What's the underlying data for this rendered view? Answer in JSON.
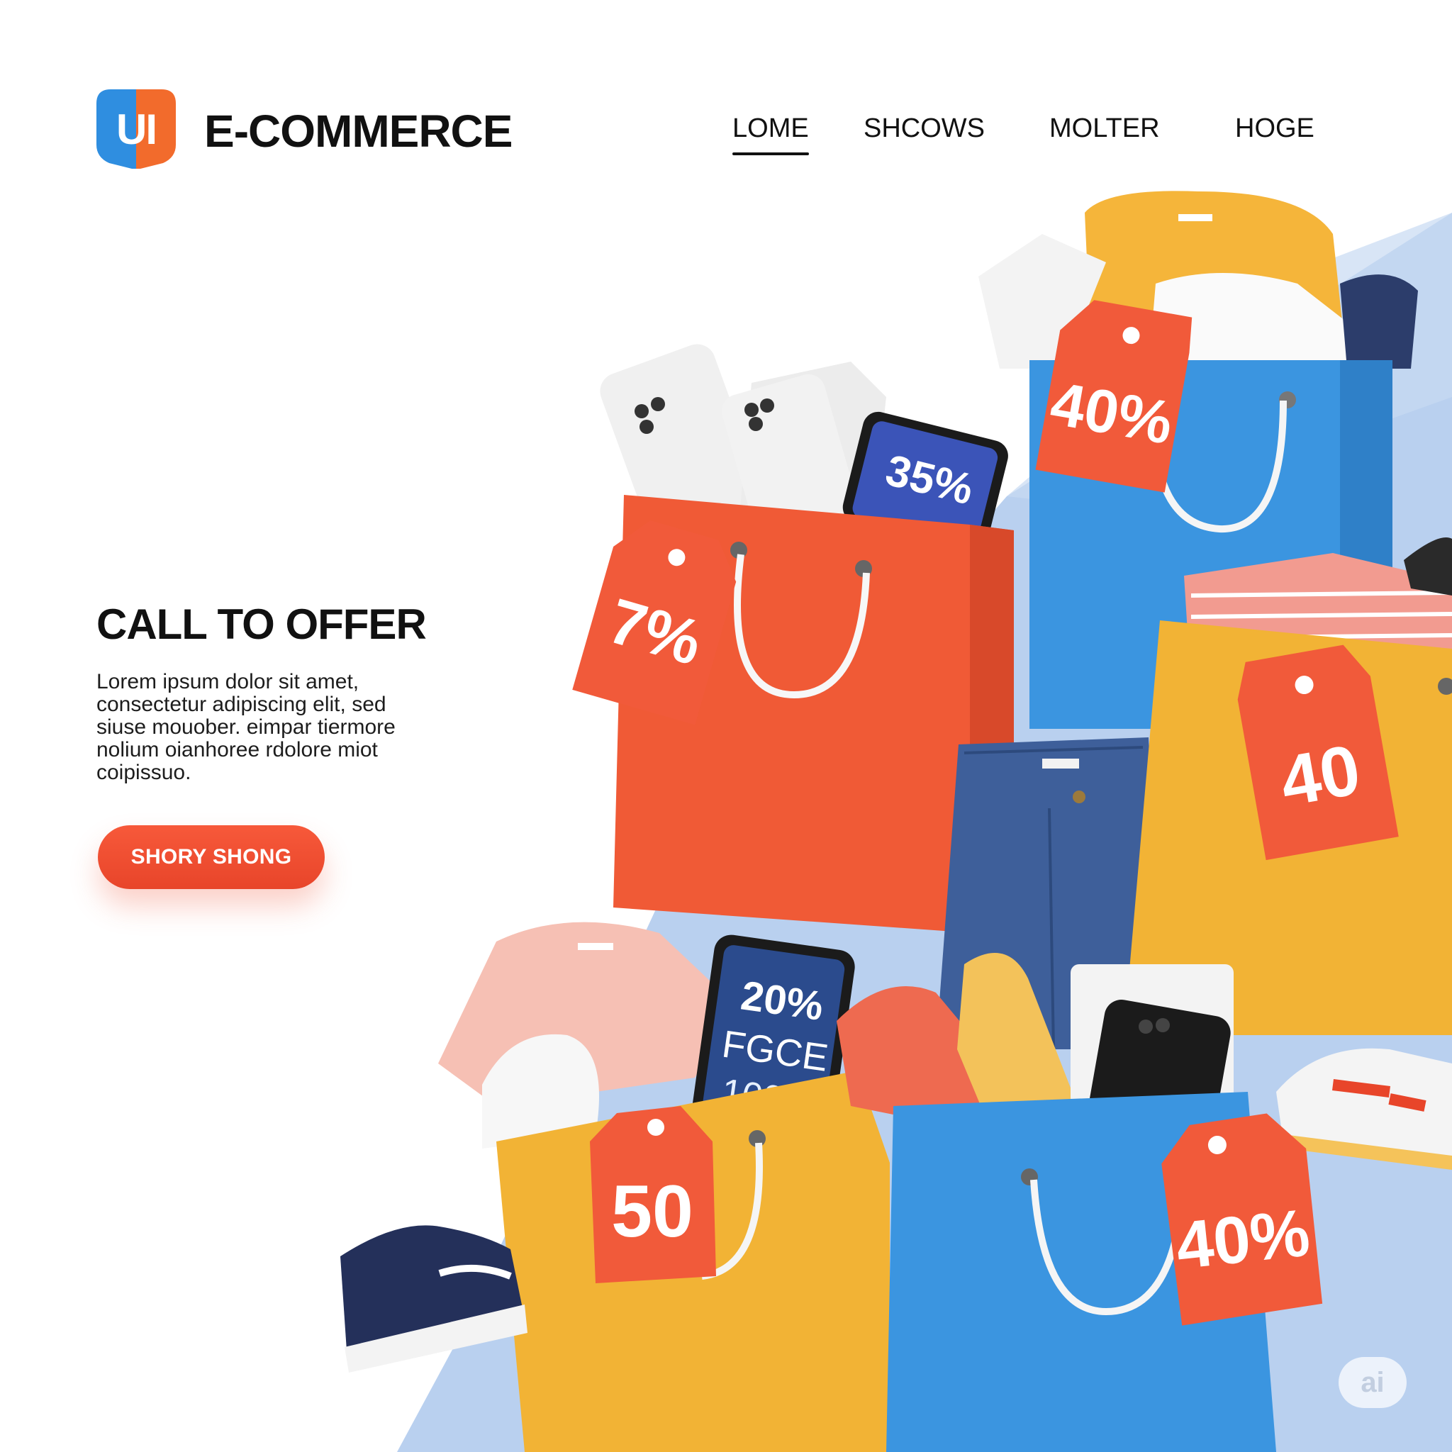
{
  "header": {
    "logo_text": "UI",
    "brand_name": "E-COMMERCE",
    "nav": [
      {
        "label": "LOME",
        "active": true
      },
      {
        "label": "SHCOWS",
        "active": false
      },
      {
        "label": "MOLTER",
        "active": false
      },
      {
        "label": "HOGE",
        "active": false
      }
    ]
  },
  "hero": {
    "title": "CALL TO OFFER",
    "body_lines": [
      "Lorem ipsum dolor sit amet,",
      "consectetur adipiscing elit, sed",
      "siuse mouober. eimpar tiermore",
      "nolium oianhoree rdolore miot",
      "coipissuo."
    ],
    "cta_label": "SHORY SHONG"
  },
  "discount_tags": [
    {
      "label": "7%",
      "color": "#f15a3a"
    },
    {
      "label": "40%",
      "color": "#f15a3a"
    },
    {
      "label": "40",
      "color": "#f15a3a"
    },
    {
      "label": "50",
      "color": "#f15a3a"
    },
    {
      "label": "40%",
      "color": "#f15a3a"
    }
  ],
  "phone_screens": [
    {
      "lines": [
        "35%"
      ]
    },
    {
      "lines": [
        "20%",
        "FGCE",
        "100%"
      ]
    }
  ],
  "colors": {
    "accent": "#f15a3a",
    "bag_orange": "#f05a36",
    "bag_blue": "#3b95e0",
    "bag_yellow": "#f2b335",
    "backdrop_blue": "#b9d0ef"
  },
  "watermark": "ai"
}
